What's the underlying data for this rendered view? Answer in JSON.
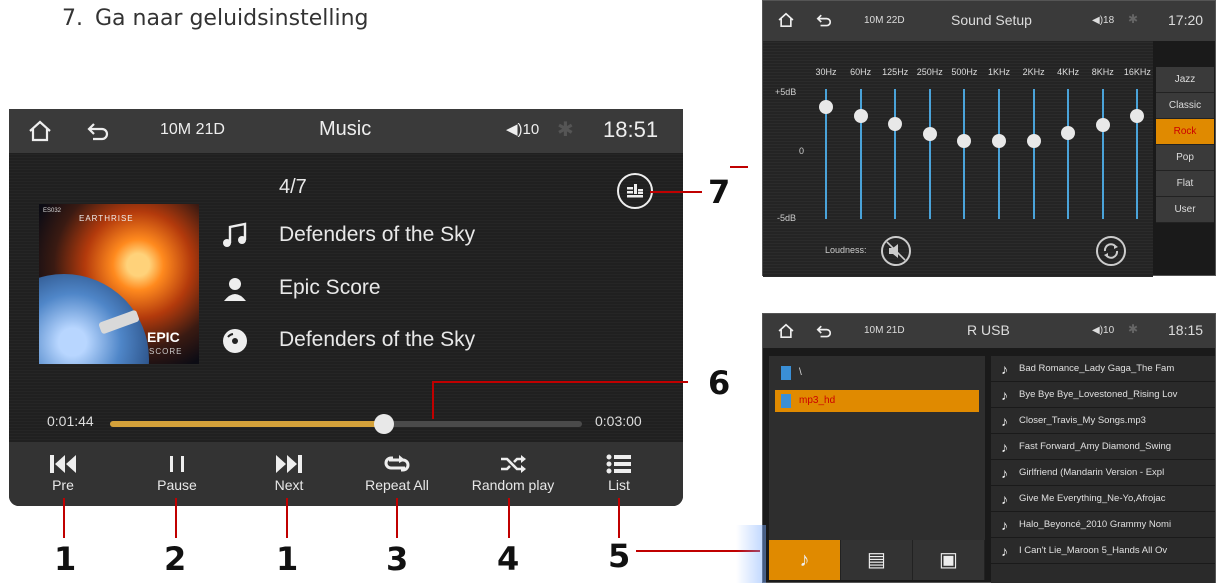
{
  "caption": {
    "number": "7.",
    "text": "Ga naar geluidsinstelling"
  },
  "music": {
    "status": {
      "date": "10M 21D",
      "title": "Music",
      "volume": "10",
      "time": "18:51"
    },
    "track_count": "4/7",
    "title": "Defenders of the Sky",
    "artist": "Epic Score",
    "album": "Defenders of the Sky",
    "album_art": {
      "top_label": "EARTHRISE",
      "corner_label": "ES032",
      "logo_label": "EPIC",
      "sub_label": "SCORE"
    },
    "progress": {
      "current": "0:01:44",
      "duration": "0:03:00",
      "fraction": 0.58
    },
    "controls": [
      {
        "label": "Pre",
        "icon": "skip-previous-icon"
      },
      {
        "label": "Pause",
        "icon": "pause-icon"
      },
      {
        "label": "Next",
        "icon": "skip-next-icon"
      },
      {
        "label": "Repeat All",
        "icon": "repeat-icon"
      },
      {
        "label": "Random play",
        "icon": "shuffle-icon"
      },
      {
        "label": "List",
        "icon": "list-icon"
      }
    ]
  },
  "callouts": [
    "1",
    "2",
    "1",
    "3",
    "4",
    "5",
    "6",
    "7"
  ],
  "sound_setup": {
    "status": {
      "date": "10M 22D",
      "title": "Sound Setup",
      "volume": "18",
      "time": "17:20"
    },
    "db_labels": [
      "+5dB",
      "0",
      "-5dB"
    ],
    "bands": [
      {
        "freq": "30Hz",
        "level": 4.3
      },
      {
        "freq": "60Hz",
        "level": 3.5
      },
      {
        "freq": "125Hz",
        "level": 2.7
      },
      {
        "freq": "250Hz",
        "level": 1.8
      },
      {
        "freq": "500Hz",
        "level": 1.2
      },
      {
        "freq": "1KHz",
        "level": 1.2
      },
      {
        "freq": "2KHz",
        "level": 1.2
      },
      {
        "freq": "4KHz",
        "level": 1.9
      },
      {
        "freq": "8KHz",
        "level": 2.6
      },
      {
        "freq": "16KHz",
        "level": 3.5
      }
    ],
    "loudness_label": "Loudness:",
    "presets": [
      "Jazz",
      "Classic",
      "Rock",
      "Pop",
      "Flat",
      "User"
    ],
    "active_preset": "Rock"
  },
  "usb": {
    "status": {
      "date": "10M 21D",
      "title": "R USB",
      "volume": "10",
      "time": "18:15"
    },
    "folders": [
      "\\",
      "mp3_hd"
    ],
    "active_folder": "mp3_hd",
    "songs": [
      "Bad Romance_Lady Gaga_The Fam",
      "Bye Bye Bye_Lovestoned_Rising Lov",
      "Closer_Travis_My Songs.mp3",
      "Fast Forward_Amy Diamond_Swing",
      "Girlfriend (Mandarin Version - Expl",
      "Give Me Everything_Ne-Yo,Afrojac",
      "Halo_Beyoncé_2010 Grammy Nomi",
      "I Can't Lie_Maroon 5_Hands All Ov"
    ]
  },
  "colors": {
    "accent": "#e08a00",
    "callout_line": "#c00000",
    "eq_slider": "#4aa3d9",
    "progress_fill": "#d4a13a"
  }
}
